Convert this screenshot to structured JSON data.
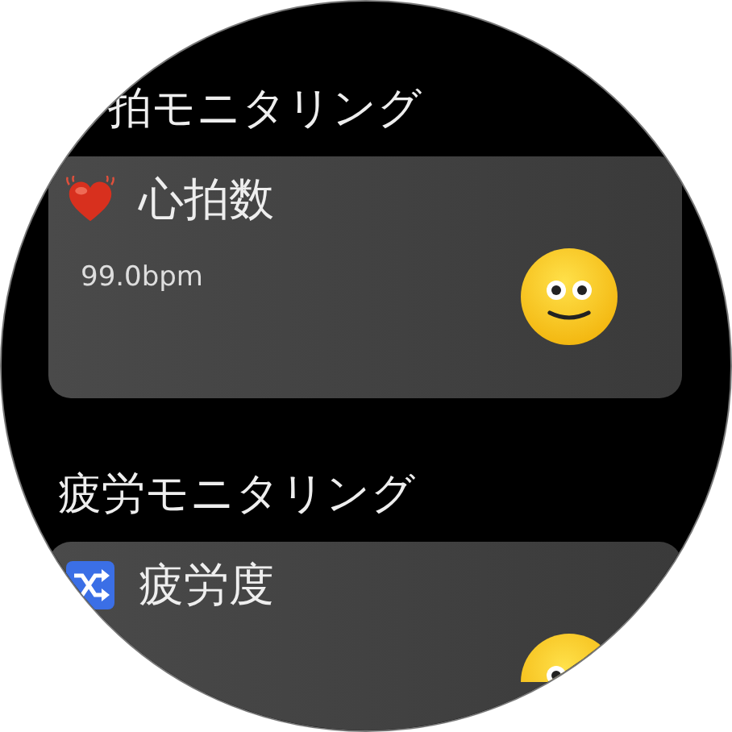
{
  "sections": [
    {
      "heading": "拍モニタリング",
      "card": {
        "title": "心拍数",
        "value": "99.0bpm"
      }
    },
    {
      "heading": "疲労モニタリング",
      "card": {
        "title": "疲労度"
      }
    }
  ]
}
